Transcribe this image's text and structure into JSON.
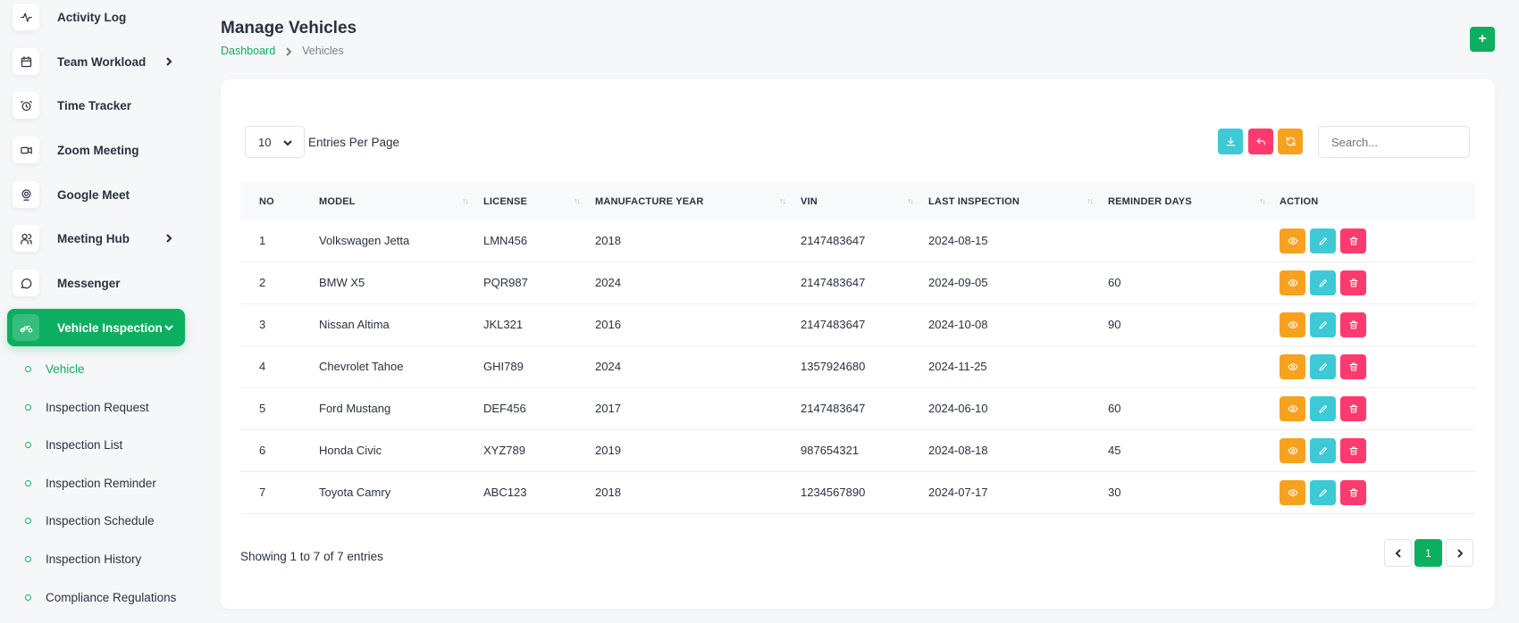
{
  "sidebar": {
    "items": [
      {
        "label": "Activity Log",
        "icon": "activity-icon"
      },
      {
        "label": "Team Workload",
        "icon": "calendar-icon",
        "has_submenu": true
      },
      {
        "label": "Time Tracker",
        "icon": "alarm-clock-icon"
      },
      {
        "label": "Zoom Meeting",
        "icon": "video-icon"
      },
      {
        "label": "Google Meet",
        "icon": "webcam-icon"
      },
      {
        "label": "Meeting Hub",
        "icon": "users-icon",
        "has_submenu": true
      },
      {
        "label": "Messenger",
        "icon": "message-icon"
      },
      {
        "label": "Vehicle Inspection",
        "icon": "motorbike-icon",
        "has_submenu": true,
        "active": true
      }
    ],
    "subitems": [
      {
        "label": "Vehicle",
        "active": true
      },
      {
        "label": "Inspection Request"
      },
      {
        "label": "Inspection List"
      },
      {
        "label": "Inspection Reminder"
      },
      {
        "label": "Inspection Schedule"
      },
      {
        "label": "Inspection History"
      },
      {
        "label": "Compliance Regulations"
      }
    ]
  },
  "header": {
    "title": "Manage Vehicles",
    "breadcrumb": {
      "link": "Dashboard",
      "current": "Vehicles"
    },
    "add_label": "+"
  },
  "toolbar": {
    "entries_value": "10",
    "entries_label": "Entries Per Page",
    "search_placeholder": "Search..."
  },
  "table": {
    "columns": [
      "NO",
      "MODEL",
      "LICENSE",
      "MANUFACTURE YEAR",
      "VIN",
      "LAST INSPECTION",
      "REMINDER DAYS",
      "ACTION"
    ],
    "rows": [
      [
        "1",
        "Volkswagen Jetta",
        "LMN456",
        "2018",
        "2147483647",
        "2024-08-15",
        ""
      ],
      [
        "2",
        "BMW X5",
        "PQR987",
        "2024",
        "2147483647",
        "2024-09-05",
        "60"
      ],
      [
        "3",
        "Nissan Altima",
        "JKL321",
        "2016",
        "2147483647",
        "2024-10-08",
        "90"
      ],
      [
        "4",
        "Chevrolet Tahoe",
        "GHI789",
        "2024",
        "1357924680",
        "2024-11-25",
        ""
      ],
      [
        "5",
        "Ford Mustang",
        "DEF456",
        "2017",
        "2147483647",
        "2024-06-10",
        "60"
      ],
      [
        "6",
        "Honda Civic",
        "XYZ789",
        "2019",
        "987654321",
        "2024-08-18",
        "45"
      ],
      [
        "7",
        "Toyota Camry",
        "ABC123",
        "2018",
        "1234567890",
        "2024-07-17",
        "30"
      ]
    ]
  },
  "footer": {
    "showing": "Showing 1 to 7 of 7 entries",
    "current_page": "1"
  },
  "colors": {
    "primary": "#0caf60",
    "info": "#3ec9d6",
    "danger": "#ff3a6e",
    "warning": "#f6a21e"
  }
}
